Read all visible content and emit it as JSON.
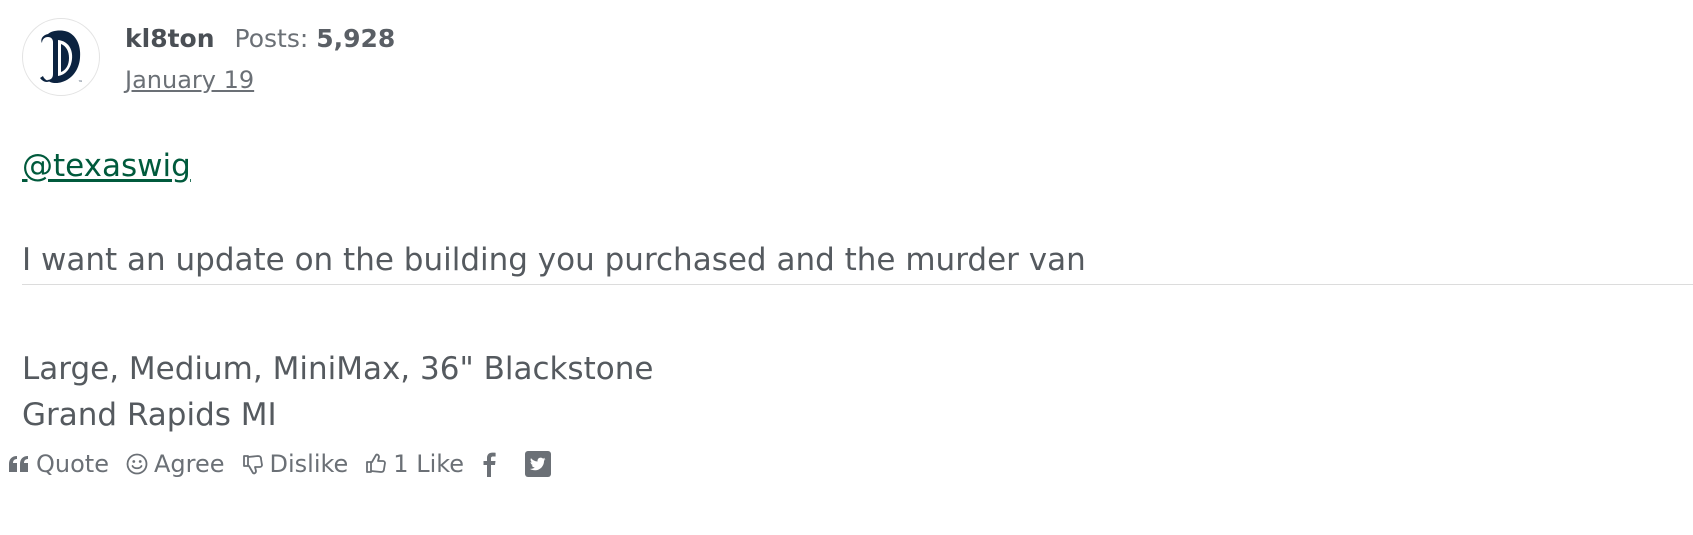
{
  "post": {
    "author": {
      "username": "kl8ton",
      "posts_label": "Posts:",
      "posts_count": "5,928",
      "avatar_icon": "tigers-old-english-d-logo"
    },
    "date": "January 19",
    "mention": "@texaswig",
    "body": "I want an update on the building you purchased and the murder van",
    "signature": [
      "Large, Medium, MiniMax, 36\" Blackstone",
      "Grand Rapids MI"
    ]
  },
  "reactions": {
    "quote": "Quote",
    "agree": "Agree",
    "dislike": "Dislike",
    "like": "1 Like"
  },
  "share": {
    "facebook_icon": "facebook-icon",
    "twitter_icon": "twitter-icon"
  },
  "colors": {
    "link": "#005a3c",
    "text": "#555a5f",
    "logo": "#0c2340"
  }
}
